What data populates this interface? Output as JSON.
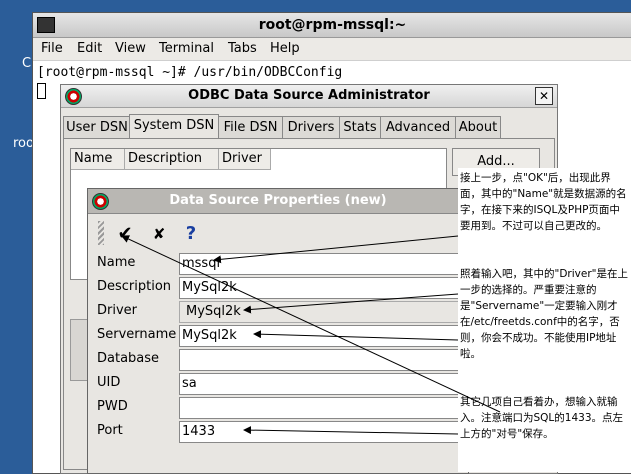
{
  "desktop": {
    "left_labels": [
      "C",
      "roo"
    ]
  },
  "terminal": {
    "title": "root@rpm-mssql:~",
    "menu": [
      "File",
      "Edit",
      "View",
      "Terminal",
      "Tabs",
      "Help"
    ],
    "command_line": "[root@rpm-mssql ~]# /usr/bin/ODBCConfig"
  },
  "odbc": {
    "title": "ODBC Data Source Administrator",
    "close_label": "✕",
    "tabs": [
      "User DSN",
      "System DSN",
      "File DSN",
      "Drivers",
      "Stats",
      "Advanced",
      "About"
    ],
    "active_tab": "System DSN",
    "columns": [
      "Name",
      "Description",
      "Driver"
    ],
    "add_button": "Add..."
  },
  "dsp": {
    "title": "Data Source Properties (new)",
    "toolbar": {
      "ok_glyph": "✔",
      "cancel_glyph": "✘",
      "help_glyph": "?"
    },
    "fields": [
      {
        "label": "Name",
        "value": "mssql"
      },
      {
        "label": "Description",
        "value": "MySql2k"
      },
      {
        "label": "Driver",
        "value": "MySql2k"
      },
      {
        "label": "Servername",
        "value": "MySql2k"
      },
      {
        "label": "Database",
        "value": ""
      },
      {
        "label": "UID",
        "value": "sa"
      },
      {
        "label": "PWD",
        "value": ""
      },
      {
        "label": "Port",
        "value": "1433"
      }
    ]
  },
  "annotation": {
    "p1": "接上一步，点\"OK\"后，出现此界面，其中的\"Name\"就是数据源的名字，在接下来的ISQL及PHP页面中要用到。不过可以自己更改的。",
    "p2": "照着输入吧，其中的\"Driver\"是在上一步的选择的。严重要注意的是\"Servername\"一定要输入刚才在/etc/freetds.conf中的名字，否则，你会不成功。不能使用IP地址啦。",
    "p3": "其它几项自己看着办，想输入就输入。注意端口为SQL的1433。点左上方的\"对号\"保存。"
  }
}
